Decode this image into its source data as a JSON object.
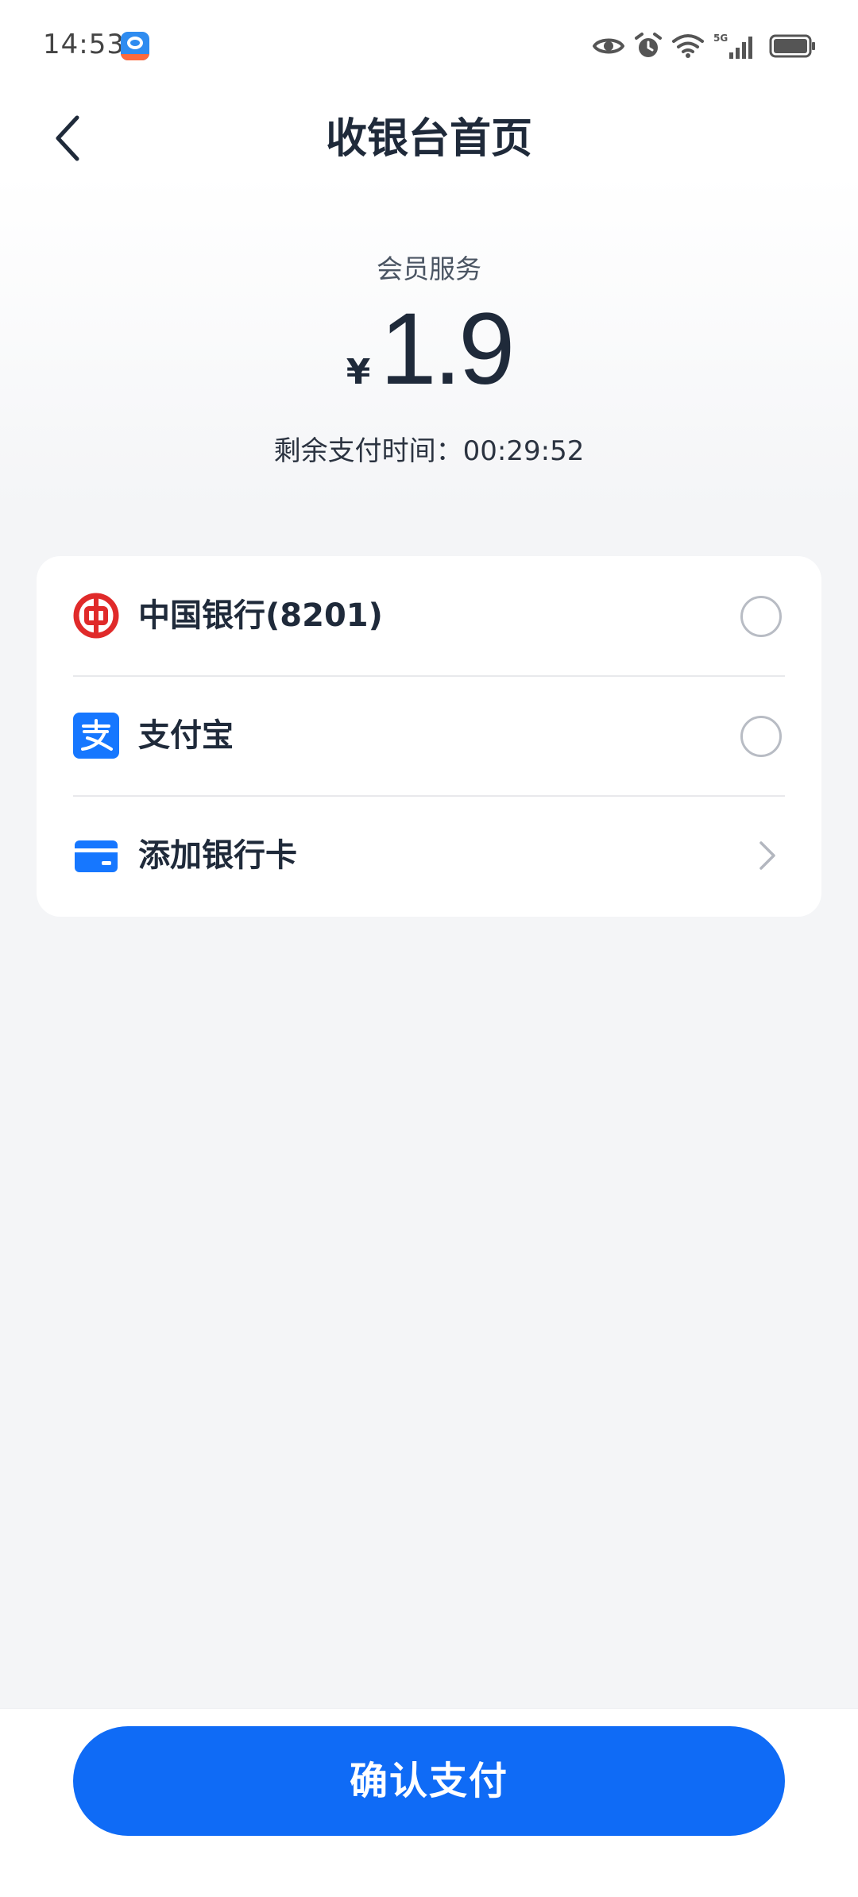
{
  "status_bar": {
    "time": "14:53",
    "app_badge_icon": "app-notification-icon",
    "icons": [
      "eye-icon",
      "alarm-icon",
      "wifi-icon",
      "5g-signal-icon",
      "battery-icon"
    ],
    "network_label": "5G"
  },
  "nav": {
    "back_icon": "chevron-left-icon",
    "title": "收银台首页"
  },
  "order": {
    "service_label": "会员服务",
    "currency": "¥",
    "amount": "1.9",
    "countdown": "剩余支付时间：00:29:52"
  },
  "payment_methods": [
    {
      "icon": "bank-of-china-icon",
      "label": "中国银行(8201)",
      "control": "radio",
      "selected": false
    },
    {
      "icon": "alipay-icon",
      "label": "支付宝",
      "control": "radio",
      "selected": false
    },
    {
      "icon": "bank-card-icon",
      "label": "添加银行卡",
      "control": "chevron-right-icon"
    }
  ],
  "confirm_button": {
    "label": "确认支付"
  },
  "colors": {
    "primary": "#0f6bf6",
    "boc_red": "#e02a2a",
    "alipay_blue": "#1677ff",
    "page_bg": "#f4f5f7",
    "title_text": "#1f2a3a"
  }
}
